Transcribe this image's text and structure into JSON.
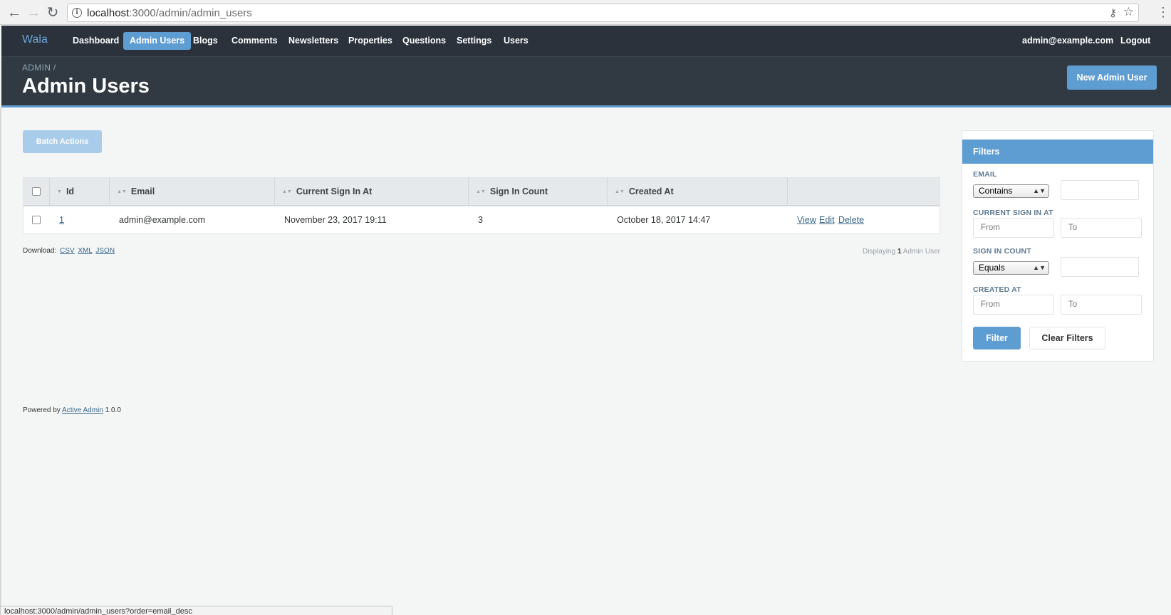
{
  "browser": {
    "url_host": "localhost",
    "url_rest": ":3000/admin/admin_users",
    "status_url": "localhost:3000/admin/admin_users?order=email_desc"
  },
  "nav": {
    "brand": "Wala",
    "items": [
      {
        "label": "Dashboard",
        "active": false
      },
      {
        "label": "Admin Users",
        "active": true
      },
      {
        "label": "Blogs",
        "active": false
      },
      {
        "label": "Comments",
        "active": false
      },
      {
        "label": "Newsletters",
        "active": false
      },
      {
        "label": "Properties",
        "active": false
      },
      {
        "label": "Questions",
        "active": false
      },
      {
        "label": "Settings",
        "active": false
      },
      {
        "label": "Users",
        "active": false
      }
    ],
    "current_user": "admin@example.com",
    "logout": "Logout"
  },
  "page": {
    "breadcrumb": "ADMIN /",
    "title": "Admin Users",
    "new_button": "New Admin User"
  },
  "batch_actions": "Batch Actions",
  "table": {
    "columns": [
      "Id",
      "Email",
      "Current Sign In At",
      "Sign In Count",
      "Created At"
    ],
    "rows": [
      {
        "id": "1",
        "email": "admin@example.com",
        "current_sign_in_at": "November 23, 2017 19:11",
        "sign_in_count": "3",
        "created_at": "October 18, 2017 14:47",
        "actions": [
          "View",
          "Edit",
          "Delete"
        ]
      }
    ]
  },
  "download": {
    "label": "Download:",
    "formats": [
      "CSV",
      "XML",
      "JSON"
    ]
  },
  "pagination": {
    "prefix": "Displaying",
    "count": "1",
    "suffix": "Admin User"
  },
  "filters": {
    "title": "Filters",
    "email": {
      "label": "EMAIL",
      "select": "Contains",
      "value": ""
    },
    "current_sign_in_at": {
      "label": "CURRENT SIGN IN AT",
      "from": "From",
      "to": "To"
    },
    "sign_in_count": {
      "label": "SIGN IN COUNT",
      "select": "Equals",
      "value": ""
    },
    "created_at": {
      "label": "CREATED AT",
      "from": "From",
      "to": "To"
    },
    "filter_button": "Filter",
    "clear_button": "Clear Filters"
  },
  "footer": {
    "prefix": "Powered by",
    "link": "Active Admin",
    "version": "1.0.0"
  },
  "colors": {
    "header_bg": "#313a43",
    "accent": "#5e9dd2",
    "link": "#38678b"
  }
}
